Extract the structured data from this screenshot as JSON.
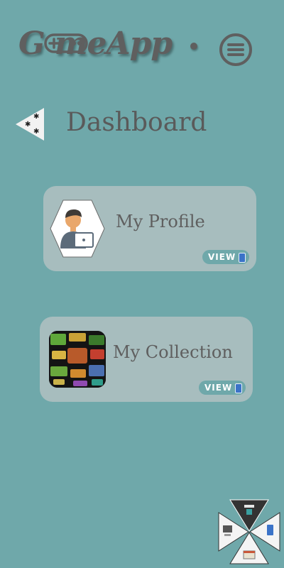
{
  "app": {
    "logo_text": "G  meApp"
  },
  "header": {
    "menu_icon": "hamburger-menu-icon"
  },
  "page": {
    "back_icon": "back-triangle-icon",
    "title": "Dashboard"
  },
  "cards": [
    {
      "label": "My Profile",
      "button": "VIEW",
      "thumb_icon": "developer-avatar-icon"
    },
    {
      "label": "My Collection",
      "button": "VIEW",
      "thumb_icon": "game-collection-thumbnail"
    }
  ],
  "fab": {
    "icons": [
      "network-icon",
      "desktop-icon",
      "mobile-icon",
      "browser-icon"
    ]
  },
  "colors": {
    "background": "#6fa8aa",
    "card": "#a7bdbe",
    "text": "#5f5f5f"
  }
}
